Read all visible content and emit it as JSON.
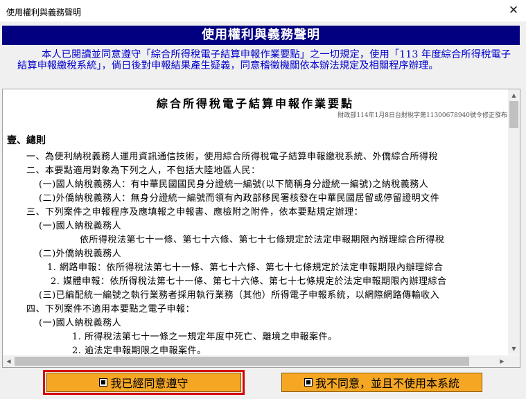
{
  "window": {
    "title": "使用權利與義務聲明",
    "close_glyph": "✕"
  },
  "header": {
    "title": "使用權利與義務聲明"
  },
  "consent_text": "本人已閱讀並同意遵守「綜合所得稅電子結算申報作業要點」之一切規定，使用「113 年度綜合所得稅電子結算申報繳稅系統」，倘日後對申報結果產生疑義，同意稽徵機關依本辦法規定及相關程序辦理。",
  "document": {
    "title": "綜合所得稅電子結算申報作業要點",
    "subtitle": "財政部114年1月8日台財稅字第11300678940號令修正發布",
    "section": "壹、總則",
    "lines": [
      "一、為便利納稅義務人運用資訊通信技術，使用綜合所得稅電子結算申報繳稅系統、外僑綜合所得稅",
      "二、本要點適用對象為下列之人，不包括大陸地區人民：",
      "(一)國人納稅義務人：有中華民國國民身分證統一編號(以下簡稱身分證統一編號)之納稅義務人",
      "(二)外僑納稅義務人：無身分證統一編號而領有內政部移民署核發在中華民國居留或停留證明文件",
      "三、下列案件之申報程序及應填報之申報書、應檢附之附件，依本要點規定辦理：",
      "(一)國人納稅義務人",
      "依所得稅法第七十一條、第七十六條、第七十七條規定於法定申報期限內辦理綜合所得稅",
      "(二)外僑納稅義務人",
      "1. 網路申報：依所得稅法第七十一條、第七十六條、第七十七條規定於法定申報期限內辦理綜合",
      "2. 媒體申報：依所得稅法第七十一條、第七十六條、第七十七條規定於法定申報期限內辦理綜合",
      "(三)已編配統一編號之執行業務者採用執行業務（其他）所得電子申報系統，以網際網路傳輸收入",
      "四、下列案件不適用本要點之電子申報：",
      "(一)國人納稅義務人",
      "1. 所得稅法第七十一條之一規定年度中死亡、離境之申報案件。",
      "2. 逾法定申報期限之申報案件。"
    ]
  },
  "buttons": {
    "agree": "我已經同意遵守",
    "decline": "我不同意，並且不使用本系統"
  },
  "icons": {
    "close": "close-icon",
    "scroll_up": "arrow-up-icon",
    "scroll_down": "arrow-down-icon",
    "scroll_left": "arrow-left-icon",
    "scroll_right": "arrow-right-icon",
    "button_square": "square-bullet-icon"
  },
  "colors": {
    "header_bg": "#020080",
    "consent_text": "#0000cc",
    "button_bg": "#f5a623",
    "focus_border": "#d40000"
  }
}
